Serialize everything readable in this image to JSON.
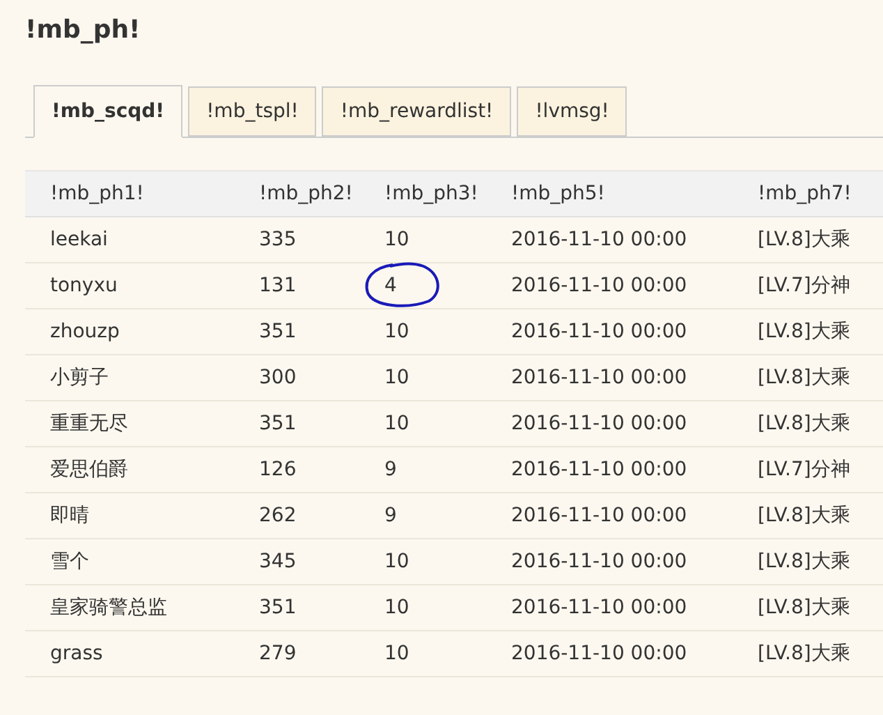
{
  "title": "!mb_ph!",
  "tabs": [
    {
      "label": "!mb_scqd!",
      "selected": true
    },
    {
      "label": "!mb_tspl!",
      "selected": false
    },
    {
      "label": "!mb_rewardlist!",
      "selected": false
    },
    {
      "label": "!lvmsg!",
      "selected": false
    }
  ],
  "table": {
    "columns": [
      "!mb_ph1!",
      "!mb_ph2!",
      "!mb_ph3!",
      "!mb_ph5!",
      "!mb_ph7!"
    ],
    "rows": [
      {
        "cells": [
          "leekai",
          "335",
          "10",
          "2016-11-10 00:00",
          "[LV.8]大乘"
        ],
        "circled": false
      },
      {
        "cells": [
          "tonyxu",
          "131",
          "4",
          "2016-11-10 00:00",
          "[LV.7]分神"
        ],
        "circled": true
      },
      {
        "cells": [
          "zhouzp",
          "351",
          "10",
          "2016-11-10 00:00",
          "[LV.8]大乘"
        ],
        "circled": false
      },
      {
        "cells": [
          "小剪子",
          "300",
          "10",
          "2016-11-10 00:00",
          "[LV.8]大乘"
        ],
        "circled": false
      },
      {
        "cells": [
          "重重无尽",
          "351",
          "10",
          "2016-11-10 00:00",
          "[LV.8]大乘"
        ],
        "circled": false
      },
      {
        "cells": [
          "爱思伯爵",
          "126",
          "9",
          "2016-11-10 00:00",
          "[LV.7]分神"
        ],
        "circled": false
      },
      {
        "cells": [
          "即晴",
          "262",
          "9",
          "2016-11-10 00:00",
          "[LV.8]大乘"
        ],
        "circled": false
      },
      {
        "cells": [
          "雪个",
          "345",
          "10",
          "2016-11-10 00:00",
          "[LV.8]大乘"
        ],
        "circled": false
      },
      {
        "cells": [
          "皇家骑警总监",
          "351",
          "10",
          "2016-11-10 00:00",
          "[LV.8]大乘"
        ],
        "circled": false
      },
      {
        "cells": [
          "grass",
          "279",
          "10",
          "2016-11-10 00:00",
          "[LV.8]大乘"
        ],
        "circled": false
      }
    ]
  }
}
